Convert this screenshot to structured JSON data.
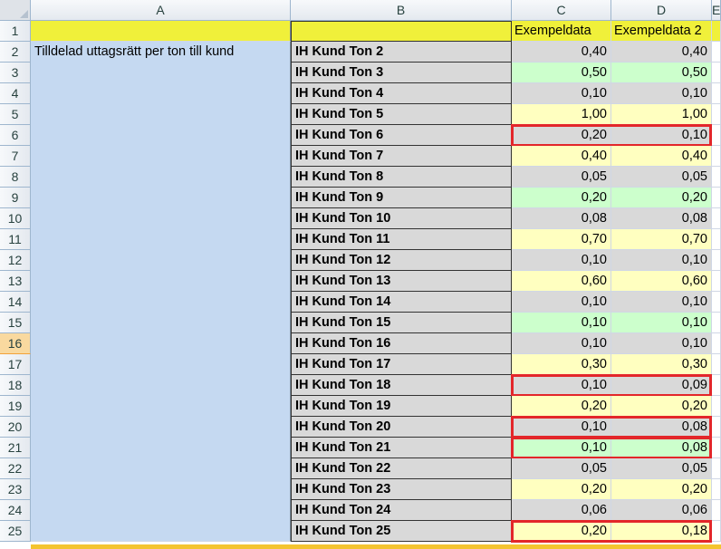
{
  "columns": [
    "A",
    "B",
    "C",
    "D",
    "E"
  ],
  "rows": [
    "1",
    "2",
    "3",
    "4",
    "5",
    "6",
    "7",
    "8",
    "9",
    "10",
    "11",
    "12",
    "13",
    "14",
    "15",
    "16",
    "17",
    "18",
    "19",
    "20",
    "21",
    "22",
    "23",
    "24",
    "25"
  ],
  "selected_row": "16",
  "header_row": {
    "c": "Exempeldata",
    "d": "Exempeldata 2"
  },
  "merged_a_label": "Tilldelad uttagsrätt per ton till kund",
  "colors": {
    "header_yellow": "#f0f03a",
    "col_a_blue": "#c5d9f1",
    "gray": "#d9d9d9",
    "light_yellow": "#ffffc0",
    "light_green": "#ccffcc",
    "highlight_red": "#e3262a"
  },
  "data_rows": [
    {
      "label": "IH Kund Ton 2",
      "c": "0,40",
      "d": "0,40",
      "fill": "gray",
      "changed": false
    },
    {
      "label": "IH Kund Ton 3",
      "c": "0,50",
      "d": "0,50",
      "fill": "green",
      "changed": false
    },
    {
      "label": "IH Kund Ton 4",
      "c": "0,10",
      "d": "0,10",
      "fill": "gray",
      "changed": false
    },
    {
      "label": "IH Kund Ton 5",
      "c": "1,00",
      "d": "1,00",
      "fill": "yellow",
      "changed": false
    },
    {
      "label": "IH Kund Ton 6",
      "c": "0,20",
      "d": "0,10",
      "fill": "gray",
      "changed": true
    },
    {
      "label": "IH Kund Ton 7",
      "c": "0,40",
      "d": "0,40",
      "fill": "yellow",
      "changed": false
    },
    {
      "label": "IH Kund Ton 8",
      "c": "0,05",
      "d": "0,05",
      "fill": "gray",
      "changed": false
    },
    {
      "label": "IH Kund Ton 9",
      "c": "0,20",
      "d": "0,20",
      "fill": "green",
      "changed": false
    },
    {
      "label": "IH Kund Ton 10",
      "c": "0,08",
      "d": "0,08",
      "fill": "gray",
      "changed": false
    },
    {
      "label": "IH Kund Ton 11",
      "c": "0,70",
      "d": "0,70",
      "fill": "yellow",
      "changed": false
    },
    {
      "label": "IH Kund Ton 12",
      "c": "0,10",
      "d": "0,10",
      "fill": "gray",
      "changed": false
    },
    {
      "label": "IH Kund Ton 13",
      "c": "0,60",
      "d": "0,60",
      "fill": "yellow",
      "changed": false
    },
    {
      "label": "IH Kund Ton 14",
      "c": "0,10",
      "d": "0,10",
      "fill": "gray",
      "changed": false
    },
    {
      "label": "IH Kund Ton 15",
      "c": "0,10",
      "d": "0,10",
      "fill": "green",
      "changed": false
    },
    {
      "label": "IH Kund Ton 16",
      "c": "0,10",
      "d": "0,10",
      "fill": "gray",
      "changed": false
    },
    {
      "label": "IH Kund Ton 17",
      "c": "0,30",
      "d": "0,30",
      "fill": "yellow",
      "changed": false
    },
    {
      "label": "IH Kund Ton 18",
      "c": "0,10",
      "d": "0,09",
      "fill": "gray",
      "changed": true
    },
    {
      "label": "IH Kund Ton 19",
      "c": "0,20",
      "d": "0,20",
      "fill": "yellow",
      "changed": false
    },
    {
      "label": "IH Kund Ton 20",
      "c": "0,10",
      "d": "0,08",
      "fill": "gray",
      "changed": true
    },
    {
      "label": "IH Kund Ton 21",
      "c": "0,10",
      "d": "0,08",
      "fill": "green",
      "changed": true
    },
    {
      "label": "IH Kund Ton 22",
      "c": "0,05",
      "d": "0,05",
      "fill": "gray",
      "changed": false
    },
    {
      "label": "IH Kund Ton 23",
      "c": "0,20",
      "d": "0,20",
      "fill": "yellow",
      "changed": false
    },
    {
      "label": "IH Kund Ton 24",
      "c": "0,06",
      "d": "0,06",
      "fill": "gray",
      "changed": false
    },
    {
      "label": "IH Kund Ton 25",
      "c": "0,20",
      "d": "0,18",
      "fill": "yellow",
      "changed": true
    }
  ]
}
